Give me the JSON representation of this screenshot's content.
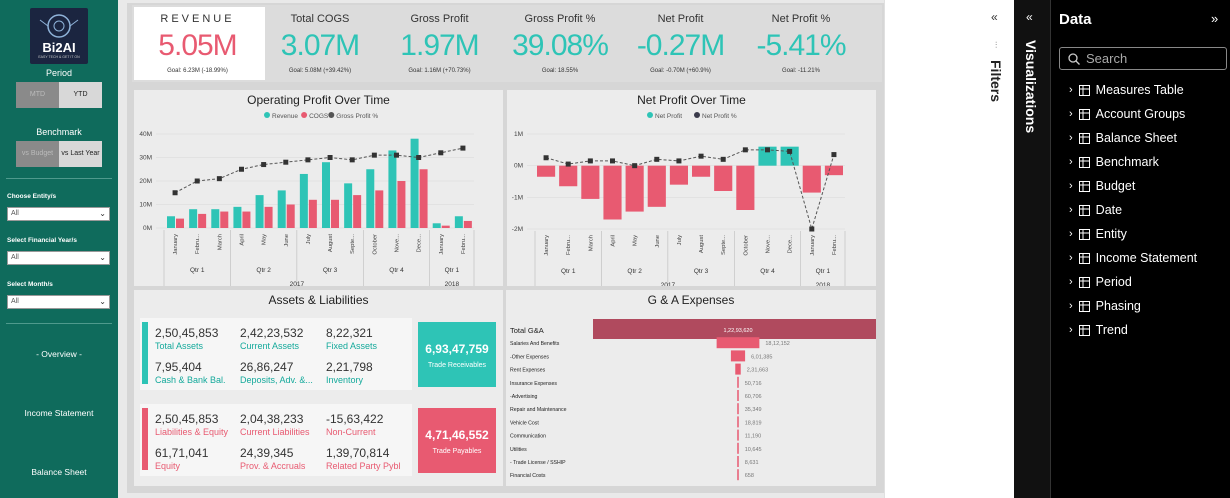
{
  "brand": {
    "logo_text": "Bi2AI",
    "logo_sub": "EASY TECH & GET IT ON"
  },
  "sidebar": {
    "period_label": "Period",
    "mtd": "MTD",
    "ytd": "YTD",
    "benchmark_label": "Benchmark",
    "vs_budget": "vs Budget",
    "vs_last_year": "vs Last Year",
    "entity_label": "Choose Entity/s",
    "entity_value": "All",
    "fy_label": "Select Financial Year/s",
    "fy_value": "All",
    "month_label": "Select Month/s",
    "month_value": "All",
    "links": [
      "- Overview -",
      "Income Statement",
      "Balance Sheet"
    ]
  },
  "kpis": [
    {
      "title": "REVENUE",
      "value": "5.05M",
      "goal": "Goal: 6.23M (-18.99%)",
      "color": "#e85a71"
    },
    {
      "title": "Total COGS",
      "value": "3.07M",
      "goal": "Goal: 5.08M (+39.42%)",
      "color": "#2ec4b6"
    },
    {
      "title": "Gross Profit",
      "value": "1.97M",
      "goal": "Goal: 1.16M (+70.73%)",
      "color": "#2ec4b6"
    },
    {
      "title": "Gross Profit %",
      "value": "39.08%",
      "goal": "Goal: 18.55%",
      "color": "#2ec4b6"
    },
    {
      "title": "Net Profit",
      "value": "-0.27M",
      "goal": "Goal: -0.70M (+60.9%)",
      "color": "#2ec4b6"
    },
    {
      "title": "Net Profit %",
      "value": "-5.41%",
      "goal": "Goal: -11.21%",
      "color": "#2ec4b6"
    }
  ],
  "chart_data": [
    {
      "type": "bar",
      "title": "Operating Profit Over Time",
      "legend": [
        "Revenue",
        "COGS",
        "Gross Profit %"
      ],
      "yticks": [
        "40M",
        "30M",
        "20M",
        "10M",
        "0M"
      ],
      "ylim": [
        0,
        40
      ],
      "categories": [
        "January",
        "Febru...",
        "March",
        "April",
        "May",
        "June",
        "July",
        "August",
        "Septe...",
        "October",
        "Nove...",
        "Dece...",
        "January",
        "Febru..."
      ],
      "series": [
        {
          "name": "Revenue",
          "values": [
            5,
            8,
            8,
            9,
            14,
            16,
            23,
            28,
            19,
            25,
            33,
            38,
            2,
            5
          ]
        },
        {
          "name": "COGS",
          "values": [
            4,
            6,
            7,
            7,
            9,
            10,
            12,
            12,
            14,
            16,
            20,
            25,
            1,
            3
          ]
        },
        {
          "name": "Gross Profit %",
          "values": [
            15,
            20,
            21,
            25,
            27,
            28,
            29,
            30,
            29,
            31,
            31,
            30,
            32,
            34
          ]
        }
      ],
      "quarters": [
        "Qtr 1",
        "Qtr 2",
        "Qtr 3",
        "Qtr 4",
        "Qtr 1"
      ],
      "years": [
        "2017",
        "2018"
      ]
    },
    {
      "type": "bar",
      "title": "Net Profit Over Time",
      "legend": [
        "Net Profit",
        "Net Profit %"
      ],
      "yticks": [
        "1M",
        "0M",
        "-1M",
        "-2M"
      ],
      "ylim": [
        -2,
        1
      ],
      "categories": [
        "January",
        "Febru...",
        "March",
        "April",
        "May",
        "June",
        "July",
        "August",
        "Septe...",
        "October",
        "Nove...",
        "Dece...",
        "January",
        "Febru..."
      ],
      "series": [
        {
          "name": "Net Profit",
          "values": [
            -0.35,
            -0.65,
            -1.05,
            -1.7,
            -1.45,
            -1.3,
            -0.6,
            -0.35,
            -0.8,
            -1.4,
            0.6,
            0.6,
            -0.85,
            -0.3
          ]
        },
        {
          "name": "Net Profit %",
          "values": [
            0.25,
            0.05,
            0.15,
            0.15,
            0.0,
            0.2,
            0.15,
            0.3,
            0.2,
            0.5,
            0.5,
            0.45,
            -2.0,
            0.35
          ]
        }
      ],
      "quarters": [
        "Qtr 1",
        "Qtr 2",
        "Qtr 3",
        "Qtr 4",
        "Qtr 1"
      ],
      "years": [
        "2017",
        "2018"
      ]
    },
    {
      "type": "bar",
      "title": "G & A Expenses",
      "categories": [
        "Total G&A",
        "Salaries And Benefits",
        "-Other Expenses",
        "Rent Expenses",
        "Insurance Expenses",
        "-Advertising",
        "Repair and Maintenance",
        "Vehicle Cost",
        "Communication",
        "Utilities",
        "- Trade License / SSHIP",
        "Financial Costs"
      ],
      "values": [
        12293620,
        1812152,
        601385,
        231663,
        50716,
        60706,
        35349,
        18819,
        11190,
        10645,
        8631,
        658
      ],
      "labels": [
        "1,22,93,620",
        "18,12,152",
        "6,01,385",
        "2,31,663",
        "50,716",
        "60,706",
        "35,349",
        "18,819",
        "11,190",
        "10,645",
        "8,631",
        "658"
      ]
    }
  ],
  "assets": {
    "title": "Assets & Liabilities",
    "asset_vals": [
      [
        "2,50,45,853",
        "Total Assets"
      ],
      [
        "2,42,23,532",
        "Current Assets"
      ],
      [
        "8,22,321",
        "Fixed Assets"
      ],
      [
        "7,95,404",
        "Cash & Bank Bal."
      ],
      [
        "26,86,247",
        "Deposits, Adv. &..."
      ],
      [
        "2,21,798",
        "Inventory"
      ]
    ],
    "liab_vals": [
      [
        "2,50,45,853",
        "Liabilities & Equity"
      ],
      [
        "2,04,38,233",
        "Current Liabilities"
      ],
      [
        "-15,63,422",
        "Non-Current"
      ],
      [
        "61,71,041",
        "Equity"
      ],
      [
        "24,39,345",
        "Prov. & Accruals"
      ],
      [
        "1,39,70,814",
        "Related Party Pybl"
      ]
    ],
    "receivables": {
      "value": "6,93,47,759",
      "label": "Trade Receivables"
    },
    "payables": {
      "value": "4,71,46,552",
      "label": "Trade Payables"
    }
  },
  "panes": {
    "filters": "Filters",
    "visualizations": "Visualizations",
    "data_title": "Data",
    "search_placeholder": "Search",
    "tables": [
      "Measures Table",
      "Account Groups",
      "Balance Sheet",
      "Benchmark",
      "Budget",
      "Date",
      "Entity",
      "Income Statement",
      "Period",
      "Phasing",
      "Trend"
    ]
  },
  "colors": {
    "teal": "#2ec4b6",
    "pink": "#e85a71",
    "dark": "#3a3a4a",
    "nav": "#0f6b5c"
  }
}
